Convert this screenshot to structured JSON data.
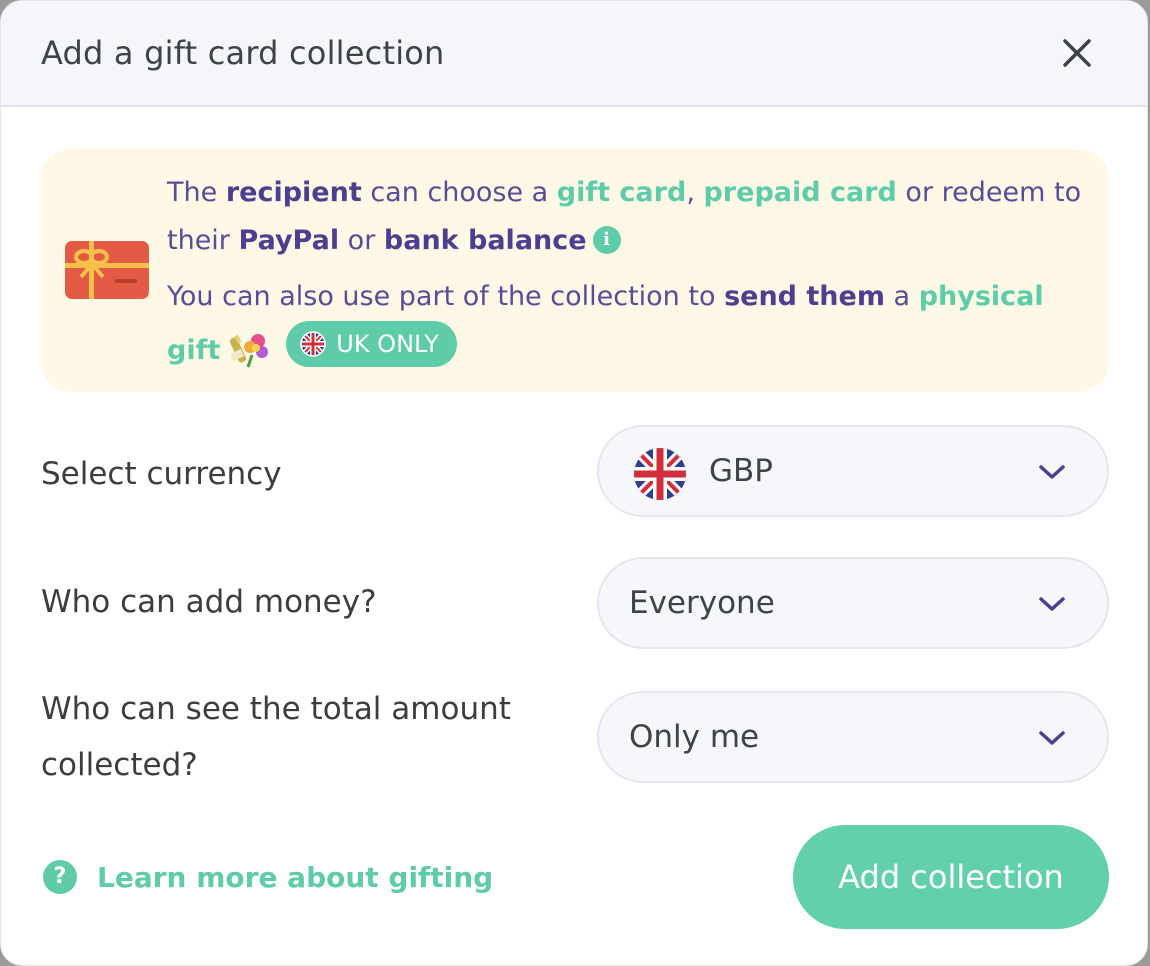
{
  "modal": {
    "title": "Add a gift card collection",
    "close_icon": "close-icon"
  },
  "info": {
    "line1": {
      "t1": "The ",
      "recipient": "recipient",
      "t2": " can choose a ",
      "gift_card": "gift card",
      "t3": ", ",
      "prepaid_card": "prepaid card",
      "t4": " or redeem to their ",
      "paypal": "PayPal",
      "t5": " or ",
      "bank_balance": "bank balance"
    },
    "line2": {
      "t1": "You can also use part of the collection to ",
      "send_them": "send them",
      "t2": " a ",
      "physical_gift": "physical gift"
    },
    "badge": "UK ONLY",
    "icons": [
      "gift-card-icon",
      "info-icon",
      "champagne-flowers-icon",
      "uk-flag-icon"
    ]
  },
  "form": {
    "currency": {
      "label": "Select currency",
      "value": "GBP",
      "flag_icon": "uk-flag-icon"
    },
    "who_add": {
      "label": "Who can add money?",
      "value": "Everyone"
    },
    "who_see": {
      "label": "Who can see the total amount collected?",
      "value": "Only me"
    }
  },
  "footer": {
    "learn_more": "Learn more about gifting",
    "help_icon": "?",
    "add_button": "Add collection"
  },
  "colors": {
    "accent": "#62cfad",
    "purple": "#4f3d8f",
    "info_bg": "#fef9e6",
    "header_bg": "#f5f6f9"
  }
}
